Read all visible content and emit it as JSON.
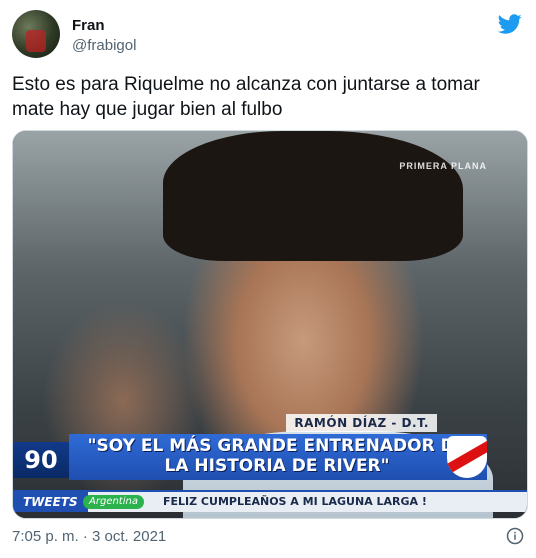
{
  "author": {
    "name": "Fran",
    "handle": "@frabigol",
    "avatar_icon": "avatar-photo",
    "logo_icon": "twitter-bird-icon",
    "brand_color": "#1d9bf0"
  },
  "tweet": {
    "text": "Esto es para Riquelme no alcanza con juntarse a tomar mate hay que jugar bien al fulbo"
  },
  "media": {
    "channel_logo": "PRIMERA PLANA",
    "name_strip": "RAMÓN DÍAZ - D.T.",
    "number": "90",
    "quote": "\"SOY EL MÁS GRANDE ENTRENADOR DE LA HISTORIA DE RIVER\"",
    "ticker_label": "TWEETS",
    "ticker_country": "Argentina",
    "ticker_text": "FELIZ CUMPLEAÑOS A MI LAGUNA LARGA !"
  },
  "footer": {
    "timestamp": "7:05 p. m. · 3 oct. 2021",
    "info_icon": "info-icon"
  }
}
